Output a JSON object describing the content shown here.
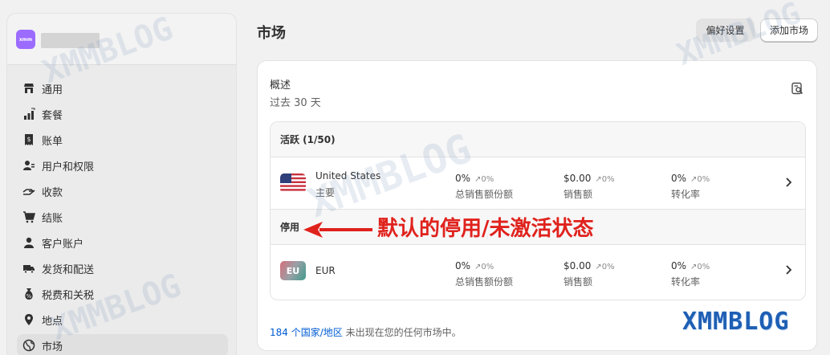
{
  "store": {
    "avatar_text": "xmm"
  },
  "sidebar": {
    "items": [
      {
        "label": "通用",
        "icon": "store-icon"
      },
      {
        "label": "套餐",
        "icon": "plan-icon"
      },
      {
        "label": "账单",
        "icon": "billing-icon"
      },
      {
        "label": "用户和权限",
        "icon": "users-icon"
      },
      {
        "label": "收款",
        "icon": "payments-icon"
      },
      {
        "label": "结账",
        "icon": "cart-icon"
      },
      {
        "label": "客户账户",
        "icon": "person-icon"
      },
      {
        "label": "发货和配送",
        "icon": "truck-icon"
      },
      {
        "label": "税费和关税",
        "icon": "tax-icon"
      },
      {
        "label": "地点",
        "icon": "location-icon"
      },
      {
        "label": "市场",
        "icon": "globe-icon"
      }
    ]
  },
  "header": {
    "title": "市场",
    "preferences_label": "偏好设置",
    "add_market_label": "添加市场"
  },
  "overview": {
    "title": "概述",
    "period": "过去 30 天"
  },
  "active_section": {
    "label": "活跃 (1/50)"
  },
  "inactive_section": {
    "label": "停用"
  },
  "markets": [
    {
      "name": "United States",
      "subtitle": "主要",
      "metrics": [
        {
          "value": "0%",
          "change": "↗0%",
          "label": "总销售额份额"
        },
        {
          "value": "$0.00",
          "change": "↗0%",
          "label": "销售额"
        },
        {
          "value": "0%",
          "change": "↗0%",
          "label": "转化率"
        }
      ]
    },
    {
      "name": "EUR",
      "badge": "EU",
      "metrics": [
        {
          "value": "0%",
          "change": "↗0%",
          "label": "总销售额份额"
        },
        {
          "value": "$0.00",
          "change": "↗0%",
          "label": "销售额"
        },
        {
          "value": "0%",
          "change": "↗0%",
          "label": "转化率"
        }
      ]
    }
  ],
  "footer": {
    "link_text": "184 个国家/地区",
    "rest_text": " 未出现在您的任何市场中。"
  },
  "annotation": {
    "text": "默认的停用/未激活状态",
    "color": "#e0221d"
  },
  "watermark": {
    "text": "XMMBLOG"
  }
}
